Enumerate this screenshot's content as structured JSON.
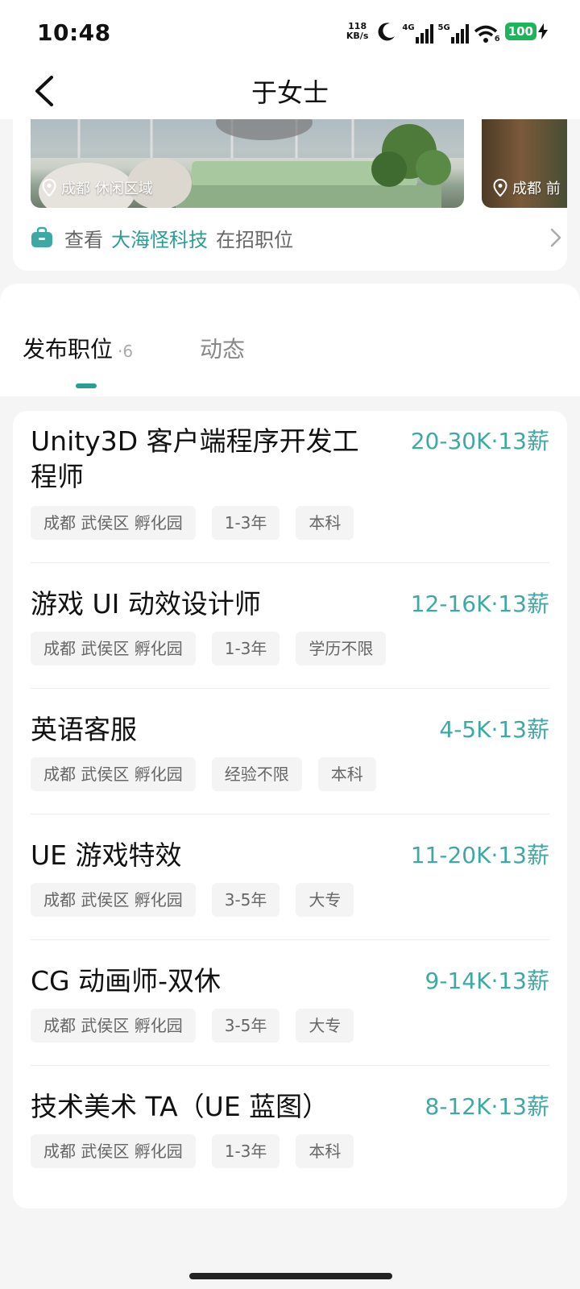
{
  "status_bar": {
    "time": "10:48",
    "net_speed_value": "118",
    "net_speed_unit": "KB/s",
    "signal_1_label": "4G",
    "signal_2_label": "5G",
    "wifi_badge": "6",
    "battery": "100"
  },
  "navbar": {
    "title": "于女士"
  },
  "company": {
    "photos": [
      {
        "location": "成都 休闲区域"
      },
      {
        "location": "成都 前"
      }
    ],
    "jobs_link": {
      "prefix": "查看",
      "company_name": "大海怪科技",
      "suffix": "在招职位"
    }
  },
  "tabs": [
    {
      "label": "发布职位",
      "count": "·6",
      "active": true
    },
    {
      "label": "动态",
      "count": "",
      "active": false
    }
  ],
  "jobs": [
    {
      "title": "Unity3D 客户端程序开发工程师",
      "salary": "20-30K·13薪",
      "tags": [
        "成都 武侯区 孵化园",
        "1-3年",
        "本科"
      ]
    },
    {
      "title": "游戏 UI 动效设计师",
      "salary": "12-16K·13薪",
      "tags": [
        "成都 武侯区 孵化园",
        "1-3年",
        "学历不限"
      ]
    },
    {
      "title": "英语客服",
      "salary": "4-5K·13薪",
      "tags": [
        "成都 武侯区 孵化园",
        "经验不限",
        "本科"
      ]
    },
    {
      "title": "UE 游戏特效",
      "salary": "11-20K·13薪",
      "tags": [
        "成都 武侯区 孵化园",
        "3-5年",
        "大专"
      ]
    },
    {
      "title": "CG 动画师-双休",
      "salary": "9-14K·13薪",
      "tags": [
        "成都 武侯区 孵化园",
        "3-5年",
        "大专"
      ]
    },
    {
      "title": "技术美术 TA（UE 蓝图）",
      "salary": "8-12K·13薪",
      "tags": [
        "成都 武侯区 孵化园",
        "1-3年",
        "本科"
      ]
    }
  ],
  "colors": {
    "accent": "#2a9d99",
    "salary": "#3ea9a4",
    "battery": "#1db45a"
  }
}
